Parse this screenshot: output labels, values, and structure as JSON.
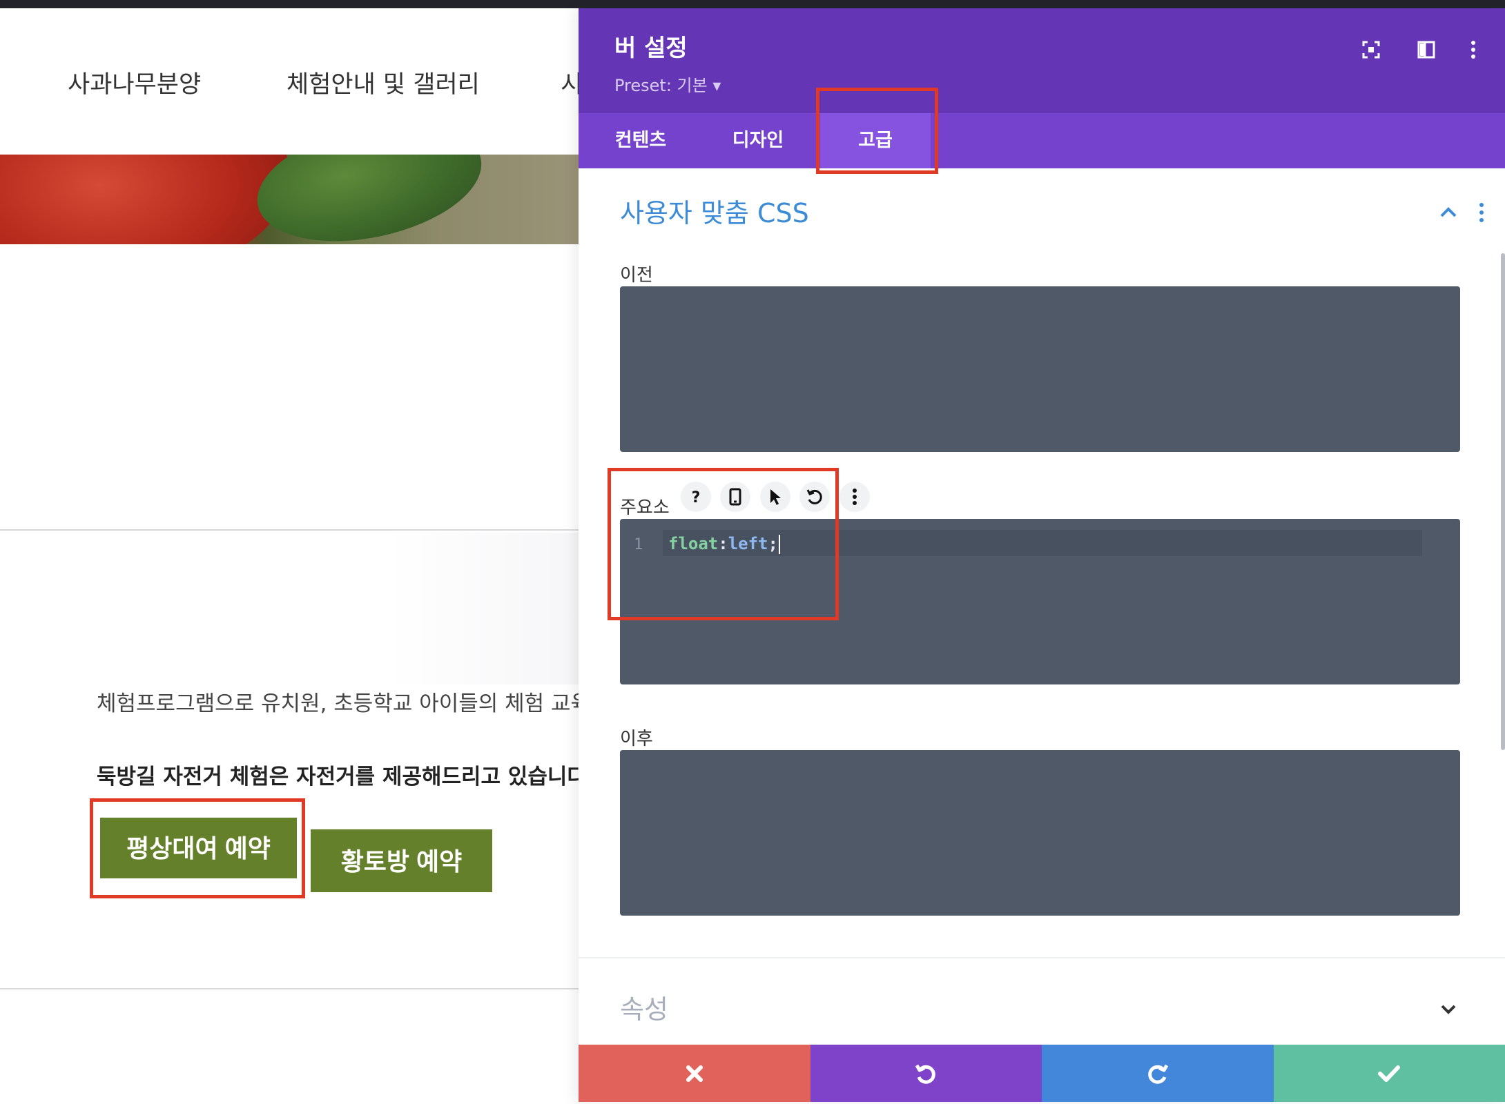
{
  "nav": {
    "items": [
      "사과나무분양",
      "체험안내 및 갤러리",
      "시"
    ]
  },
  "content": {
    "para1": "체험프로그램으로 유치원, 초등학교 아이들의 체험 교육",
    "para2": "둑방길 자전거 체험은 자전거를 제공해드리고 있습니다",
    "button_a": "평상대여 예약",
    "button_b": "황토방 예약"
  },
  "panel": {
    "title": "버 설정",
    "preset": "Preset: 기본 ▾",
    "icons": [
      "fullscreen-icon",
      "sidebar-layout-icon",
      "more-vertical-icon"
    ],
    "tabs": [
      "컨텐츠",
      "디자인",
      "고급"
    ],
    "active_tab": "고급",
    "section_title": "사용자 맞춤 CSS",
    "fields": {
      "before_label": "이전",
      "main_label": "주요소",
      "after_label": "이후"
    },
    "code": {
      "line_number": "1",
      "property": "float",
      "colon": ":",
      "value": "left",
      "semicolon": ";"
    },
    "section2_title": "속성",
    "footer": [
      "close-icon",
      "undo-icon",
      "redo-icon",
      "check-icon"
    ],
    "colors": {
      "header": "#6435b5",
      "tabs": "#7442cc",
      "accent": "#3c8bd6",
      "cancel": "#e0625a",
      "undo": "#7e43c9",
      "redo": "#4287d9",
      "save": "#5ec0a0",
      "highlight": "#e03a27"
    }
  }
}
